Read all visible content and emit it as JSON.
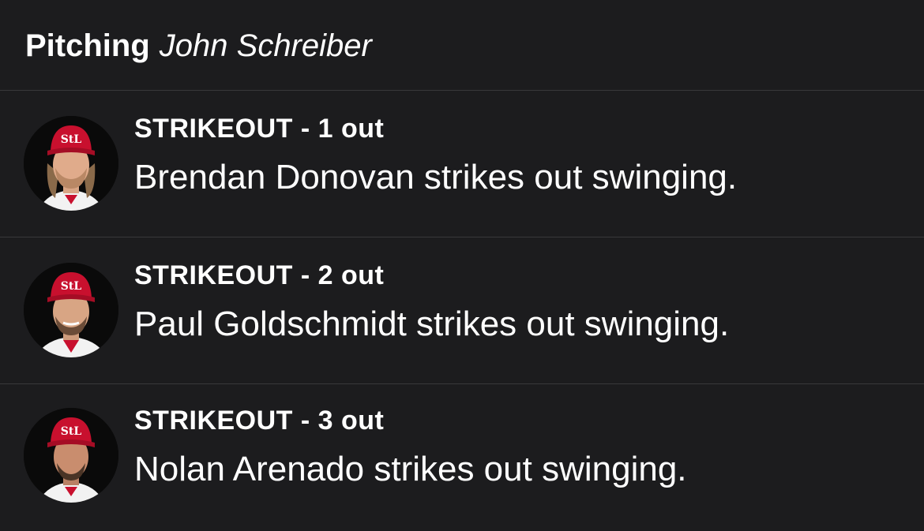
{
  "header": {
    "label": "Pitching",
    "pitcher": "John Schreiber"
  },
  "plays": [
    {
      "title": "STRIKEOUT - 1 out",
      "description": "Brendan Donovan strikes out swinging.",
      "avatar": "player-headshot-cardinals-cap"
    },
    {
      "title": "STRIKEOUT - 2 out",
      "description": "Paul Goldschmidt strikes out swinging.",
      "avatar": "player-headshot-cardinals-cap"
    },
    {
      "title": "STRIKEOUT - 3 out",
      "description": "Nolan Arenado strikes out swinging.",
      "avatar": "player-headshot-cardinals-cap"
    }
  ],
  "colors": {
    "background": "#1c1c1e",
    "divider": "#38383a",
    "text": "#ffffff",
    "cap_red": "#c8102e"
  }
}
